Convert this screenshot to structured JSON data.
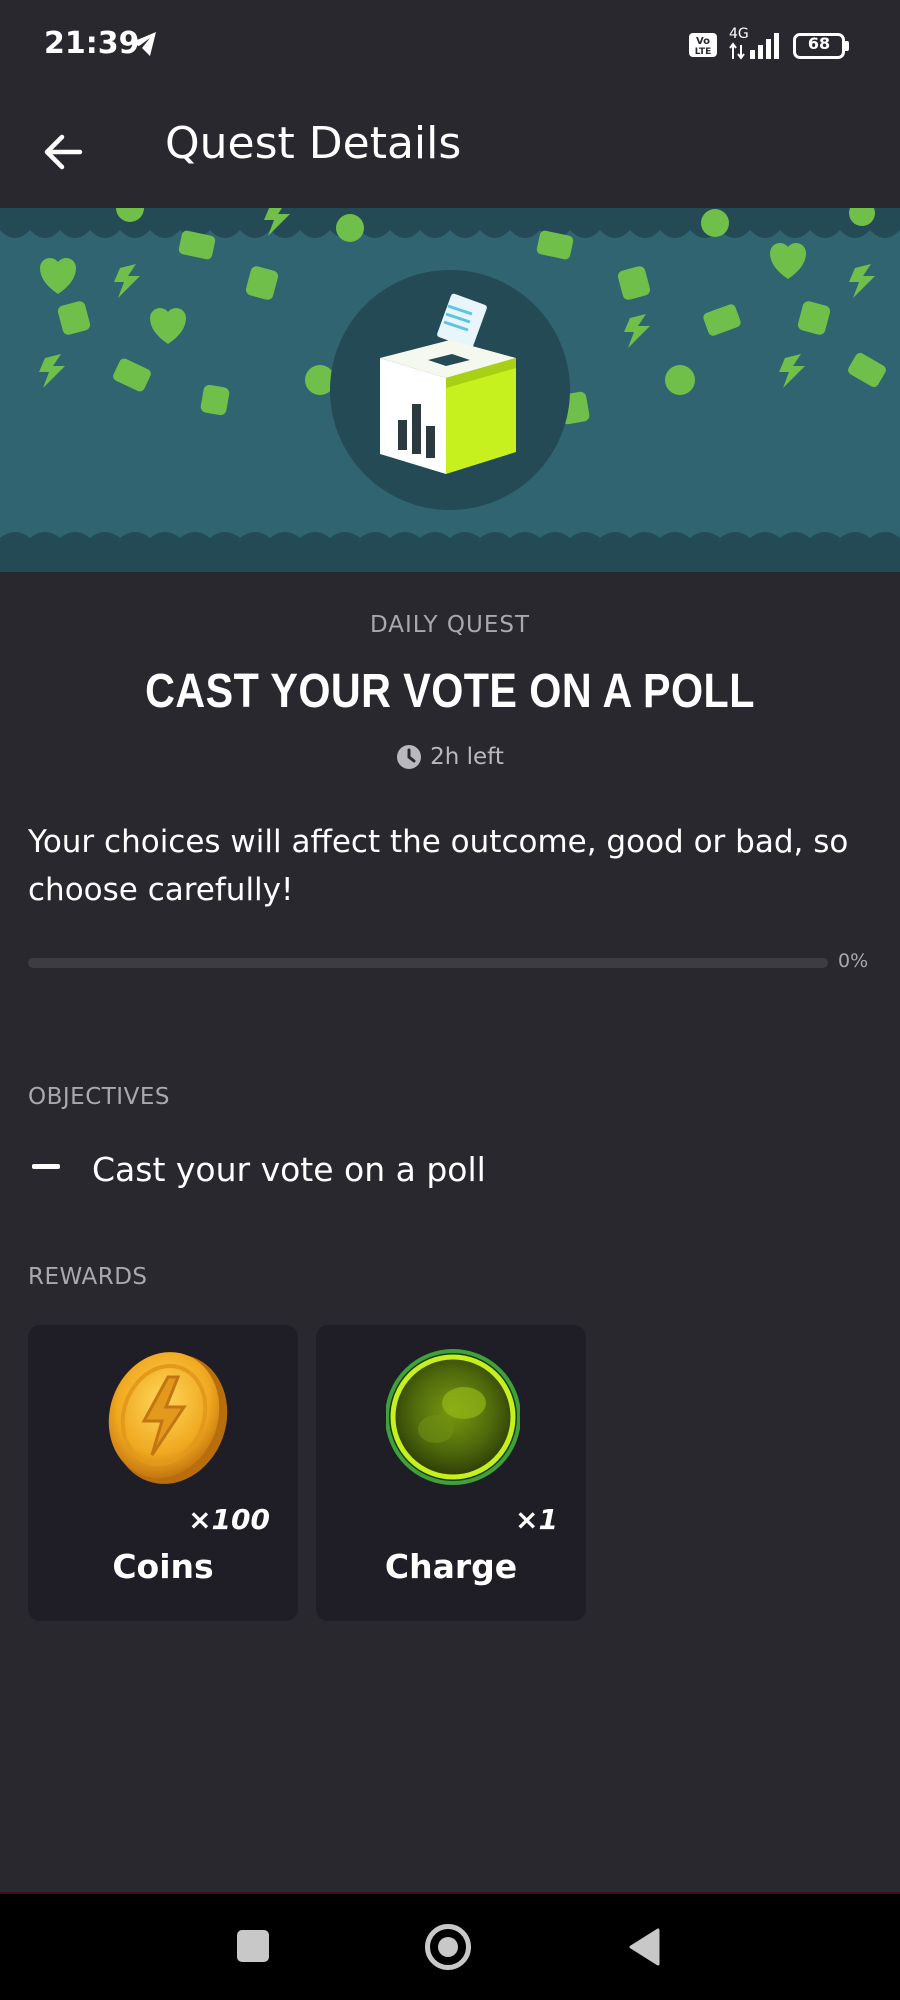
{
  "status_bar": {
    "time": "21:39",
    "network_type": "4G",
    "battery_level": "68",
    "icons": [
      "telegram-icon",
      "volte-icon",
      "signal-icon",
      "battery-icon"
    ]
  },
  "app_bar": {
    "title": "Quest Details",
    "back_icon": "arrow-left-icon"
  },
  "banner": {
    "icon": "ballot-box-icon",
    "colors": {
      "background": "#2f6470",
      "pattern": "#6fbf4a",
      "icon_accent": "#c6f01e"
    }
  },
  "quest": {
    "kind": "DAILY QUEST",
    "title": "CAST YOUR VOTE ON A POLL",
    "time_left": "2h left",
    "description": "Your choices will affect the outcome, good or bad, so choose carefully!",
    "progress_fraction": 0,
    "progress_label": "0%"
  },
  "objectives": {
    "label": "OBJECTIVES",
    "items": [
      {
        "text": "Cast your vote on a poll"
      }
    ]
  },
  "rewards": {
    "label": "REWARDS",
    "items": [
      {
        "name": "Coins",
        "quantity": "×100",
        "icon": "coin-icon"
      },
      {
        "name": "Charge",
        "quantity": "×1",
        "icon": "charge-orb-icon"
      }
    ]
  },
  "nav_bar": {
    "buttons": [
      "recent-apps-button",
      "home-button",
      "back-button"
    ]
  },
  "colors": {
    "background": "#29282f",
    "card": "#1f1e27",
    "muted_text": "#a9a8ae",
    "accent": "#b5e61d"
  }
}
